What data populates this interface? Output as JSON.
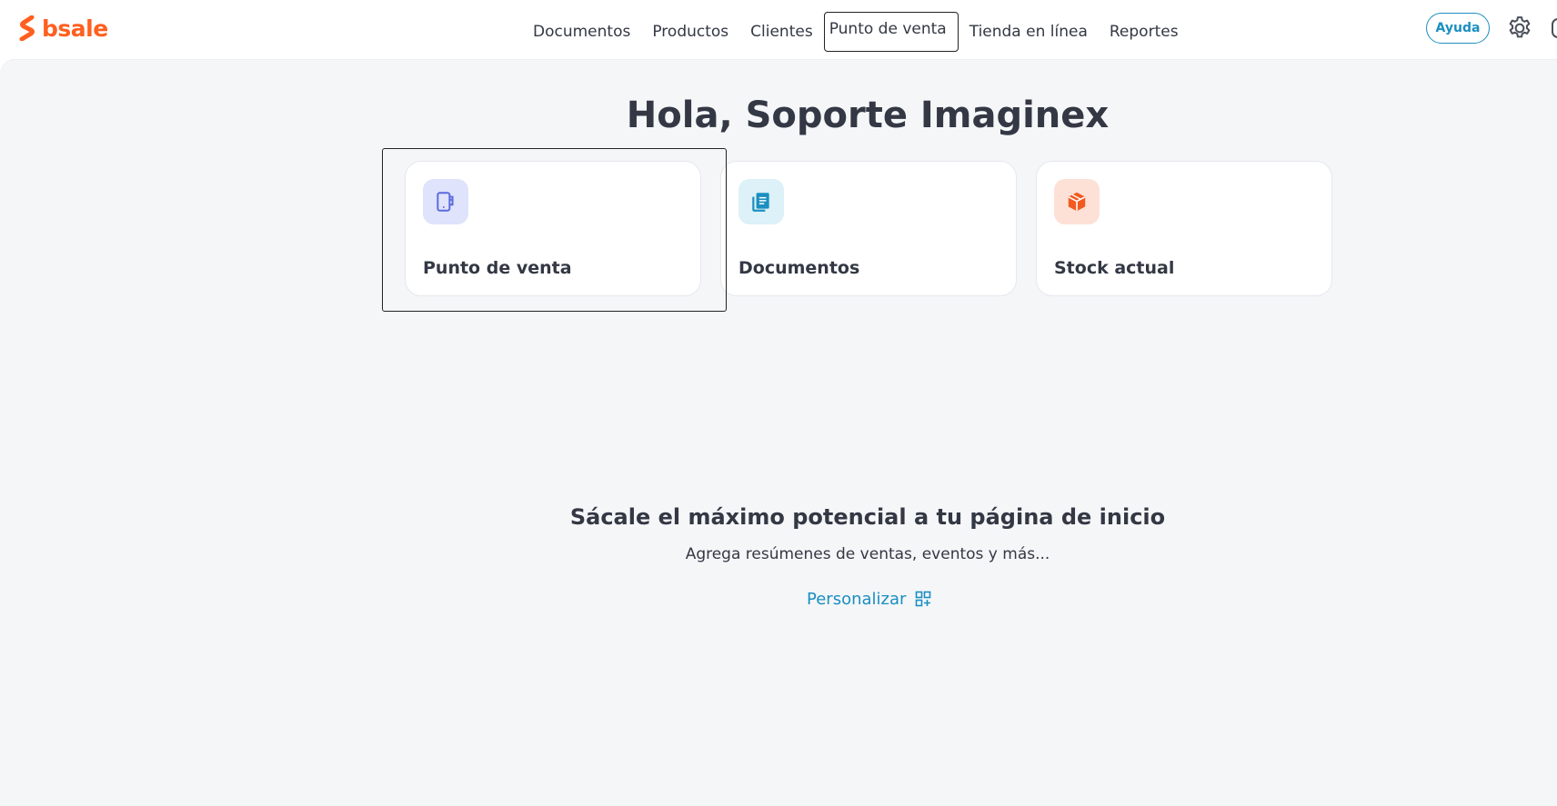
{
  "brand": {
    "name": "bsale",
    "color": "#ff5f1f"
  },
  "nav": {
    "items": [
      {
        "label": "Documentos"
      },
      {
        "label": "Productos"
      },
      {
        "label": "Clientes"
      },
      {
        "label": "Punto de venta"
      },
      {
        "label": "Tienda en línea"
      },
      {
        "label": "Reportes"
      }
    ]
  },
  "header": {
    "help_label": "Ayuda"
  },
  "main": {
    "greeting": "Hola, Soporte Imaginex",
    "cards": [
      {
        "label": "Punto de venta",
        "icon": "tablet-icon",
        "icon_color": "#5b6bdc",
        "icon_bg": "#dfe3fb"
      },
      {
        "label": "Documentos",
        "icon": "documents-icon",
        "icon_color": "#1b8fc1",
        "icon_bg": "#dcf1f8"
      },
      {
        "label": "Stock actual",
        "icon": "box-icon",
        "icon_color": "#f25a1f",
        "icon_bg": "#fde1d6"
      }
    ],
    "promo": {
      "title": "Sácale el máximo potencial a tu página de inicio",
      "subtitle": "Agrega resúmenes de ventas, eventos y más...",
      "action_label": "Personalizar"
    }
  },
  "colors": {
    "accent": "#1b8fc1",
    "background": "#f5f6f8",
    "text": "#333844"
  }
}
